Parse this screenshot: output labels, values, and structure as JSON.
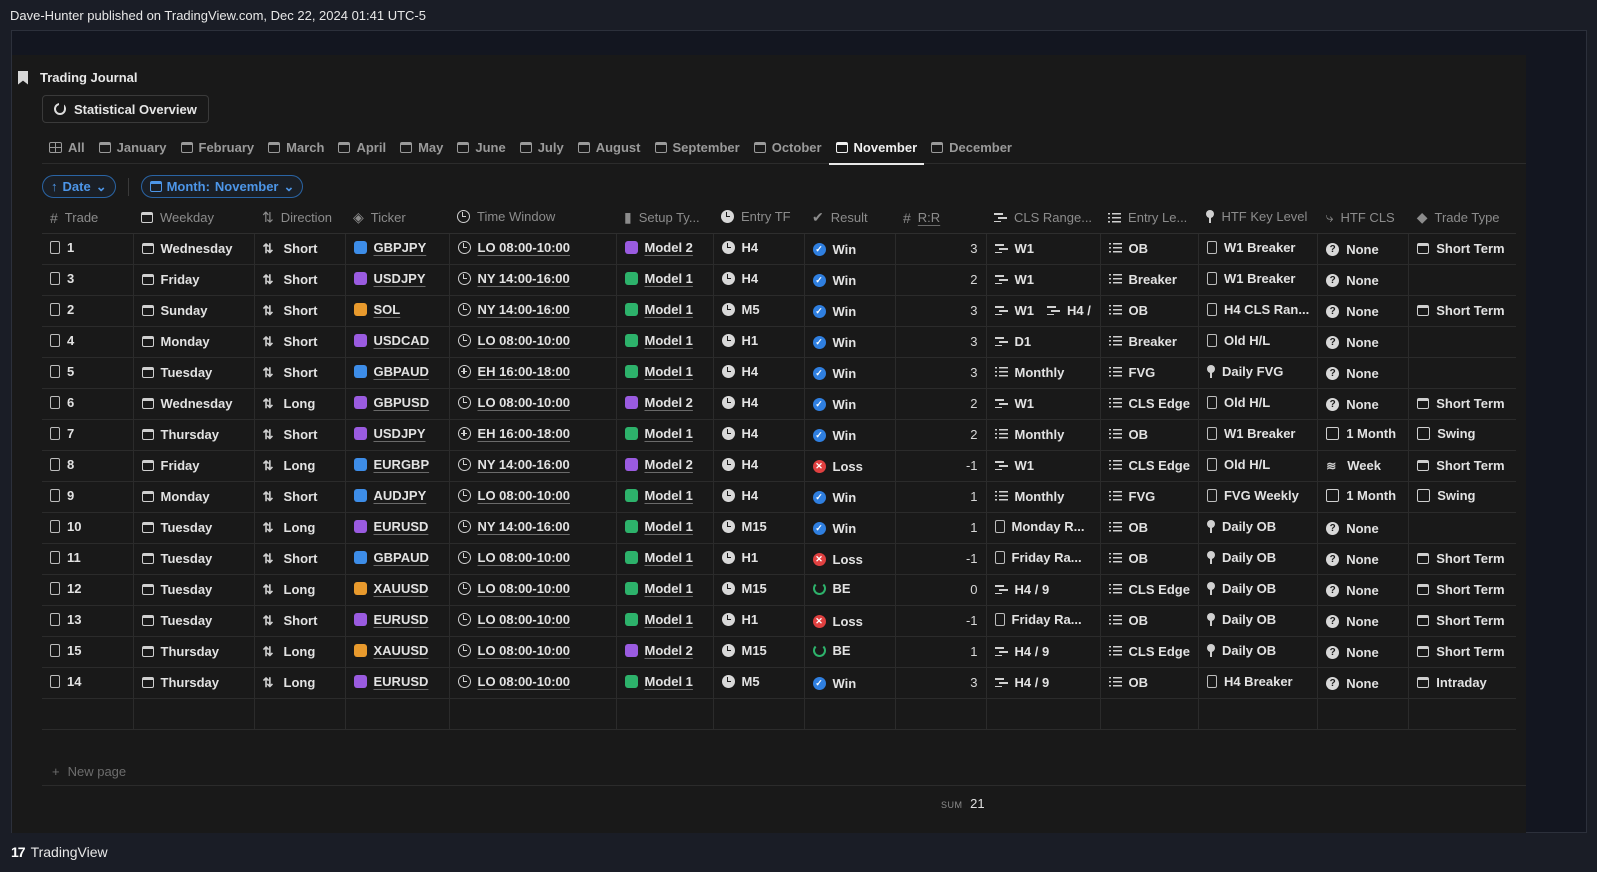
{
  "header": {
    "publisher": "Dave-Hunter published on TradingView.com, Dec 22, 2024 01:41 UTC-5"
  },
  "footer": {
    "brand": "TradingView",
    "logo_text": "17"
  },
  "journal": {
    "title": "Trading Journal",
    "overview_button": "Statistical Overview"
  },
  "tabs": [
    "All",
    "January",
    "February",
    "March",
    "April",
    "May",
    "June",
    "July",
    "August",
    "September",
    "October",
    "November",
    "December"
  ],
  "active_tab": "November",
  "filters": {
    "sort_label": "Date",
    "month_label": "Month:",
    "month_value": "November"
  },
  "columns": [
    "Trade",
    "Weekday",
    "Direction",
    "Ticker",
    "Time Window",
    "Setup Ty...",
    "Entry TF",
    "Result",
    "R:R",
    "CLS Range...",
    "Entry Le...",
    "HTF Key Level",
    "HTF CLS",
    "Trade Type"
  ],
  "colors": {
    "win": "#2f7fe0",
    "loss": "#e04040",
    "be": "#2db26b",
    "model1": "#2db26b",
    "model2": "#9a5be0",
    "ticker_blue": "#3d8de8",
    "ticker_purple": "#9a5be0",
    "ticker_orange": "#e89a2d",
    "accent": "#4d96e8"
  },
  "rows": [
    {
      "trade": "1",
      "weekday": "Wednesday",
      "direction": "Short",
      "ticker": "GBPJPY",
      "tcolor": "blue",
      "window": "LO 08:00-10:00",
      "wicon": "clock",
      "setup": "Model 2",
      "entry_tf": "H4",
      "result": "Win",
      "rr": "3",
      "cls": "W1",
      "cls2": "",
      "cls_icon": "bars",
      "entry": "OB",
      "entry_icon": "list",
      "htf_key": "W1 Breaker",
      "key_icon": "doc",
      "htf_cls": "None",
      "cls_htf_icon": "q",
      "type": "Short Term",
      "type_icon": "cal"
    },
    {
      "trade": "3",
      "weekday": "Friday",
      "direction": "Short",
      "ticker": "USDJPY",
      "tcolor": "purple",
      "window": "NY 14:00-16:00",
      "wicon": "clock",
      "setup": "Model 1",
      "entry_tf": "H4",
      "result": "Win",
      "rr": "2",
      "cls": "W1",
      "cls2": "",
      "cls_icon": "bars",
      "entry": "Breaker",
      "entry_icon": "list",
      "htf_key": "W1 Breaker",
      "key_icon": "doc",
      "htf_cls": "None",
      "cls_htf_icon": "q",
      "type": "",
      "type_icon": ""
    },
    {
      "trade": "2",
      "weekday": "Sunday",
      "direction": "Short",
      "ticker": "SOL",
      "tcolor": "orange",
      "window": "NY 14:00-16:00",
      "wicon": "clock",
      "setup": "Model 1",
      "entry_tf": "M5",
      "result": "Win",
      "rr": "3",
      "cls": "W1",
      "cls2": "H4 /",
      "cls_icon": "bars",
      "entry": "OB",
      "entry_icon": "list",
      "htf_key": "H4 CLS Ran...",
      "key_icon": "doc",
      "htf_cls": "None",
      "cls_htf_icon": "q",
      "type": "Short Term",
      "type_icon": "cal"
    },
    {
      "trade": "4",
      "weekday": "Monday",
      "direction": "Short",
      "ticker": "USDCAD",
      "tcolor": "purple",
      "window": "LO 08:00-10:00",
      "wicon": "clock",
      "setup": "Model 1",
      "entry_tf": "H1",
      "result": "Win",
      "rr": "3",
      "cls": "D1",
      "cls2": "",
      "cls_icon": "bars",
      "entry": "Breaker",
      "entry_icon": "list",
      "htf_key": "Old H/L",
      "key_icon": "doc",
      "htf_cls": "None",
      "cls_htf_icon": "q",
      "type": "",
      "type_icon": ""
    },
    {
      "trade": "5",
      "weekday": "Tuesday",
      "direction": "Short",
      "ticker": "GBPAUD",
      "tcolor": "blue",
      "window": "EH 16:00-18:00",
      "wicon": "plus",
      "setup": "Model 1",
      "entry_tf": "H4",
      "result": "Win",
      "rr": "3",
      "cls": "Monthly",
      "cls2": "",
      "cls_icon": "list",
      "entry": "FVG",
      "entry_icon": "list",
      "htf_key": "Daily FVG",
      "key_icon": "pin",
      "htf_cls": "None",
      "cls_htf_icon": "q",
      "type": "",
      "type_icon": ""
    },
    {
      "trade": "6",
      "weekday": "Wednesday",
      "direction": "Long",
      "ticker": "GBPUSD",
      "tcolor": "purple",
      "window": "LO 08:00-10:00",
      "wicon": "clock",
      "setup": "Model 2",
      "entry_tf": "H4",
      "result": "Win",
      "rr": "2",
      "cls": "W1",
      "cls2": "",
      "cls_icon": "bars",
      "entry": "CLS Edge",
      "entry_icon": "list",
      "htf_key": "Old H/L",
      "key_icon": "doc",
      "htf_cls": "None",
      "cls_htf_icon": "q",
      "type": "Short Term",
      "type_icon": "cal"
    },
    {
      "trade": "7",
      "weekday": "Thursday",
      "direction": "Short",
      "ticker": "USDJPY",
      "tcolor": "purple",
      "window": "EH 16:00-18:00",
      "wicon": "plus",
      "setup": "Model 1",
      "entry_tf": "H4",
      "result": "Win",
      "rr": "2",
      "cls": "Monthly",
      "cls2": "",
      "cls_icon": "list",
      "entry": "OB",
      "entry_icon": "list",
      "htf_key": "W1 Breaker",
      "key_icon": "doc",
      "htf_cls": "1 Month",
      "cls_htf_icon": "graph",
      "type": "Swing",
      "type_icon": "graph"
    },
    {
      "trade": "8",
      "weekday": "Friday",
      "direction": "Long",
      "ticker": "EURGBP",
      "tcolor": "blue",
      "window": "NY 14:00-16:00",
      "wicon": "clock",
      "setup": "Model 2",
      "entry_tf": "H4",
      "result": "Loss",
      "rr": "-1",
      "cls": "W1",
      "cls2": "",
      "cls_icon": "bars",
      "entry": "CLS Edge",
      "entry_icon": "list",
      "htf_key": "Old H/L",
      "key_icon": "doc",
      "htf_cls": "Week",
      "cls_htf_icon": "wave",
      "type": "Short Term",
      "type_icon": "cal"
    },
    {
      "trade": "9",
      "weekday": "Monday",
      "direction": "Short",
      "ticker": "AUDJPY",
      "tcolor": "blue",
      "window": "LO 08:00-10:00",
      "wicon": "clock",
      "setup": "Model 1",
      "entry_tf": "H4",
      "result": "Win",
      "rr": "1",
      "cls": "Monthly",
      "cls2": "",
      "cls_icon": "list",
      "entry": "FVG",
      "entry_icon": "list",
      "htf_key": "FVG Weekly",
      "key_icon": "doc",
      "htf_cls": "1 Month",
      "cls_htf_icon": "graph",
      "type": "Swing",
      "type_icon": "graph"
    },
    {
      "trade": "10",
      "weekday": "Tuesday",
      "direction": "Long",
      "ticker": "EURUSD",
      "tcolor": "purple",
      "window": "NY 14:00-16:00",
      "wicon": "clock",
      "setup": "Model 1",
      "entry_tf": "M15",
      "result": "Win",
      "rr": "1",
      "cls": "Monday R...",
      "cls2": "",
      "cls_icon": "doc",
      "entry": "OB",
      "entry_icon": "list",
      "htf_key": "Daily OB",
      "key_icon": "pin",
      "htf_cls": "None",
      "cls_htf_icon": "q",
      "type": "",
      "type_icon": ""
    },
    {
      "trade": "11",
      "weekday": "Tuesday",
      "direction": "Short",
      "ticker": "GBPAUD",
      "tcolor": "blue",
      "window": "LO 08:00-10:00",
      "wicon": "clock",
      "setup": "Model 1",
      "entry_tf": "H1",
      "result": "Loss",
      "rr": "-1",
      "cls": "Friday Ra...",
      "cls2": "",
      "cls_icon": "doc",
      "entry": "OB",
      "entry_icon": "list",
      "htf_key": "Daily OB",
      "key_icon": "pin",
      "htf_cls": "None",
      "cls_htf_icon": "q",
      "type": "Short Term",
      "type_icon": "cal"
    },
    {
      "trade": "12",
      "weekday": "Tuesday",
      "direction": "Long",
      "ticker": "XAUUSD",
      "tcolor": "orange",
      "window": "LO 08:00-10:00",
      "wicon": "clock",
      "setup": "Model 1",
      "entry_tf": "M15",
      "result": "BE",
      "rr": "0",
      "cls": "H4 / 9",
      "cls2": "",
      "cls_icon": "bars",
      "entry": "CLS Edge",
      "entry_icon": "list",
      "htf_key": "Daily OB",
      "key_icon": "pin",
      "htf_cls": "None",
      "cls_htf_icon": "q",
      "type": "Short Term",
      "type_icon": "cal"
    },
    {
      "trade": "13",
      "weekday": "Tuesday",
      "direction": "Short",
      "ticker": "EURUSD",
      "tcolor": "purple",
      "window": "LO 08:00-10:00",
      "wicon": "clock",
      "setup": "Model 1",
      "entry_tf": "H1",
      "result": "Loss",
      "rr": "-1",
      "cls": "Friday Ra...",
      "cls2": "",
      "cls_icon": "doc",
      "entry": "OB",
      "entry_icon": "list",
      "htf_key": "Daily OB",
      "key_icon": "pin",
      "htf_cls": "None",
      "cls_htf_icon": "q",
      "type": "Short Term",
      "type_icon": "cal"
    },
    {
      "trade": "15",
      "weekday": "Thursday",
      "direction": "Long",
      "ticker": "XAUUSD",
      "tcolor": "orange",
      "window": "LO 08:00-10:00",
      "wicon": "clock",
      "setup": "Model 2",
      "entry_tf": "M15",
      "result": "BE",
      "rr": "1",
      "cls": "H4 / 9",
      "cls2": "",
      "cls_icon": "bars",
      "entry": "CLS Edge",
      "entry_icon": "list",
      "htf_key": "Daily OB",
      "key_icon": "pin",
      "htf_cls": "None",
      "cls_htf_icon": "q",
      "type": "Short Term",
      "type_icon": "cal"
    },
    {
      "trade": "14",
      "weekday": "Thursday",
      "direction": "Long",
      "ticker": "EURUSD",
      "tcolor": "purple",
      "window": "LO 08:00-10:00",
      "wicon": "clock",
      "setup": "Model 1",
      "entry_tf": "M5",
      "result": "Win",
      "rr": "3",
      "cls": "H4 / 9",
      "cls2": "",
      "cls_icon": "bars",
      "entry": "OB",
      "entry_icon": "list",
      "htf_key": "H4 Breaker",
      "key_icon": "doc",
      "htf_cls": "None",
      "cls_htf_icon": "q",
      "type": "Intraday",
      "type_icon": "cal"
    }
  ],
  "new_page_label": "New page",
  "sum_label": "SUM",
  "sum_value": "21"
}
